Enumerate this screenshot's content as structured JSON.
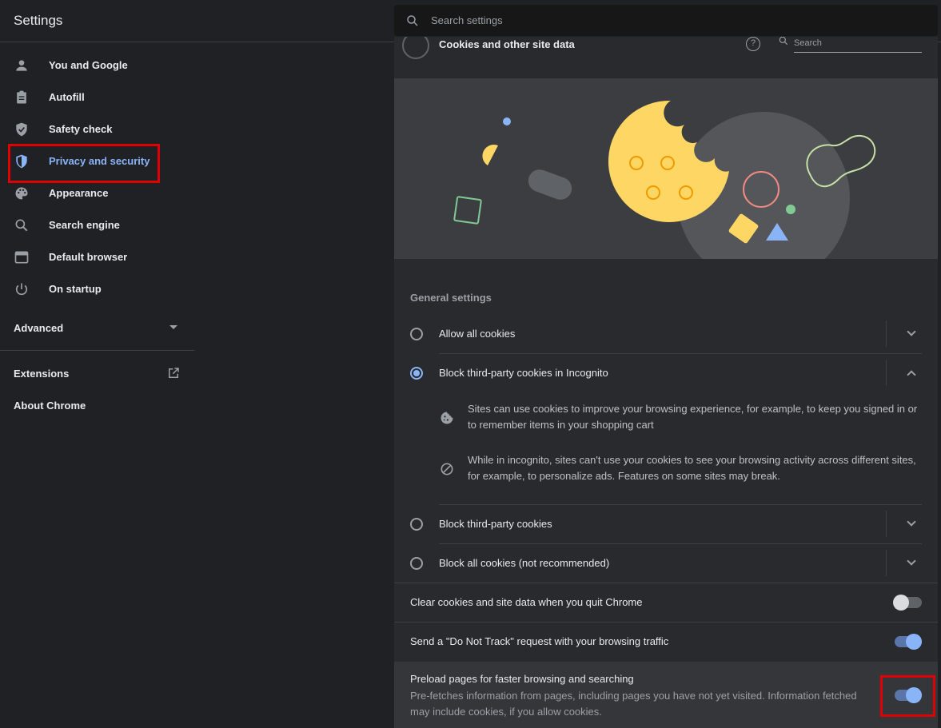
{
  "header": {
    "title": "Settings",
    "search_placeholder": "Search settings"
  },
  "sidebar": {
    "items": [
      {
        "label": "You and Google",
        "icon": "person-icon"
      },
      {
        "label": "Autofill",
        "icon": "clipboard-icon"
      },
      {
        "label": "Safety check",
        "icon": "shield-check-icon"
      },
      {
        "label": "Privacy and security",
        "icon": "shield-half-icon",
        "active": true
      },
      {
        "label": "Appearance",
        "icon": "palette-icon"
      },
      {
        "label": "Search engine",
        "icon": "search-icon"
      },
      {
        "label": "Default browser",
        "icon": "browser-window-icon"
      },
      {
        "label": "On startup",
        "icon": "power-icon"
      }
    ],
    "advanced": "Advanced",
    "extensions": "Extensions",
    "about": "About Chrome"
  },
  "page": {
    "title": "Cookies and other site data",
    "mini_search_placeholder": "Search",
    "section_label": "General settings",
    "options": [
      {
        "label": "Allow all cookies",
        "selected": false
      },
      {
        "label": "Block third-party cookies in Incognito",
        "selected": true
      },
      {
        "label": "Block third-party cookies",
        "selected": false
      },
      {
        "label": "Block all cookies (not recommended)",
        "selected": false
      }
    ],
    "incognito_details": [
      {
        "icon": "cookie-icon",
        "text": "Sites can use cookies to improve your browsing experience, for example, to keep you signed in or to remember items in your shopping cart"
      },
      {
        "icon": "block-icon",
        "text": "While in incognito, sites can't use your cookies to see your browsing activity across different sites, for example, to personalize ads. Features on some sites may break."
      }
    ],
    "toggles": [
      {
        "label": "Clear cookies and site data when you quit Chrome",
        "on": false
      },
      {
        "label": "Send a \"Do Not Track\" request with your browsing traffic",
        "on": true
      }
    ],
    "preload": {
      "title": "Preload pages for faster browsing and searching",
      "description": "Pre-fetches information from pages, including pages you have not yet visited. Information fetched may include cookies, if you allow cookies.",
      "on": true
    }
  },
  "colors": {
    "accent": "#8ab4f8",
    "highlight": "#e00000",
    "background": "#202124",
    "card": "#292a2d"
  }
}
